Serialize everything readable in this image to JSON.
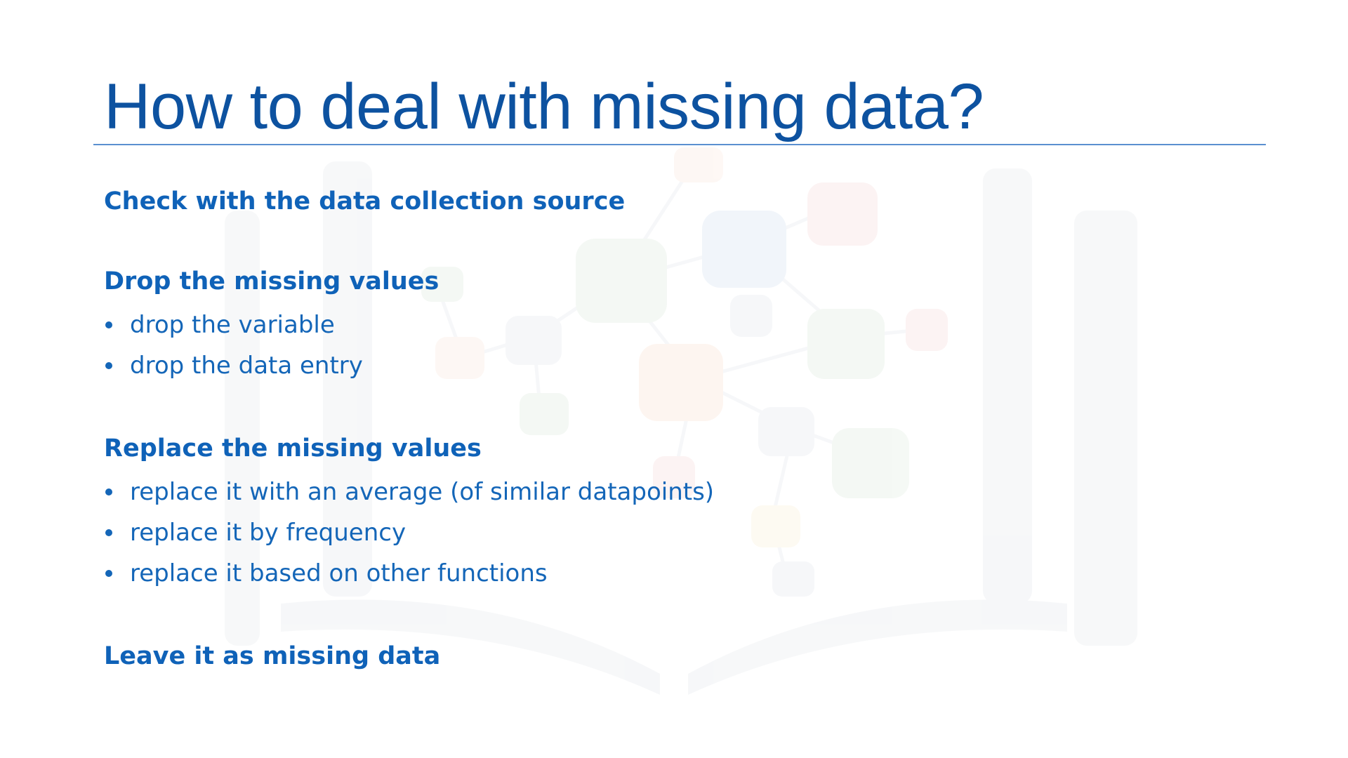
{
  "slide": {
    "title": "How to deal with missing data?",
    "sections": [
      {
        "heading": "Check with the data collection source",
        "bullets": []
      },
      {
        "heading": "Drop the missing values",
        "bullets": [
          "drop the variable",
          "drop the data entry"
        ]
      },
      {
        "heading": "Replace the missing values",
        "bullets": [
          "replace it with an average (of similar datapoints)",
          "replace it by frequency",
          "replace it based on other functions"
        ]
      },
      {
        "heading": "Leave it as missing data",
        "bullets": []
      }
    ]
  },
  "colors": {
    "title": "#0d52a0",
    "heading": "#0f62b8",
    "bullet_text": "#1466b8",
    "rule": "#5a8fd0"
  },
  "icons": {
    "watermark": "open-book-network-icon"
  }
}
